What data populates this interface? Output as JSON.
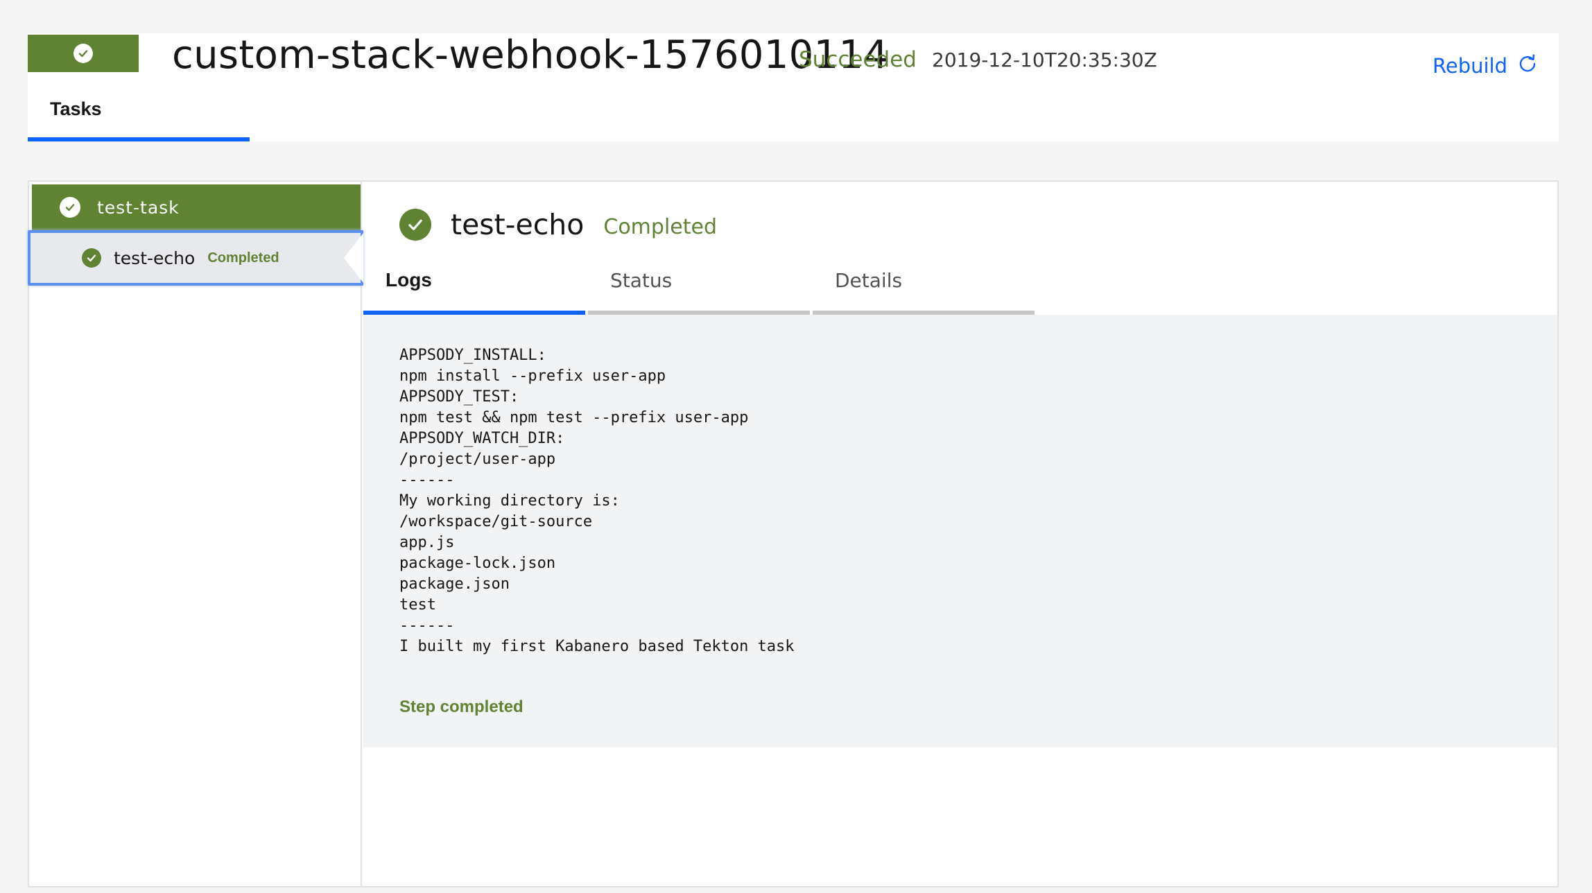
{
  "header": {
    "title": "custom-stack-webhook-1576010114",
    "status": "Succeeded",
    "timestamp": "2019-12-10T20:35:30Z",
    "rebuild_label": "Rebuild",
    "tab_label": "Tasks"
  },
  "sidebar": {
    "task_name": "test-task",
    "step": {
      "name": "test-echo",
      "status": "Completed"
    }
  },
  "detail": {
    "step_name": "test-echo",
    "step_status": "Completed",
    "tabs": [
      {
        "label": "Logs"
      },
      {
        "label": "Status"
      },
      {
        "label": "Details"
      }
    ],
    "log_lines": [
      "APPSODY_INSTALL:",
      "npm install --prefix user-app",
      "APPSODY_TEST:",
      "npm test && npm test --prefix user-app",
      "APPSODY_WATCH_DIR:",
      "/project/user-app",
      "------",
      "My working directory is:",
      "/workspace/git-source",
      "app.js",
      "package-lock.json",
      "package.json",
      "test",
      "------",
      "I built my first Kabanero based Tekton task"
    ],
    "log_footer": "Step completed"
  },
  "icons": {
    "status": "checkmark-icon",
    "rebuild": "restart-icon"
  },
  "colors": {
    "success": "#5f8233",
    "accent": "#0f62fe",
    "log_background": "#f2f3f4"
  }
}
